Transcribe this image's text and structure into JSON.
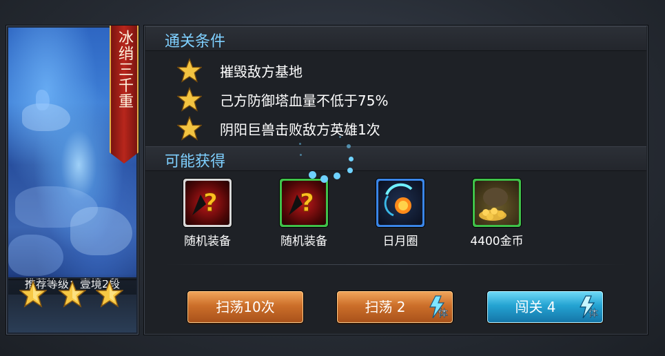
{
  "stage": {
    "name": "冰绡三千重",
    "recommended_level": "推荐等级：壹境2段",
    "stars": 3
  },
  "conditions": {
    "title": "通关条件",
    "items": [
      "摧毁敌方基地",
      "己方防御塔血量不低于75%",
      "阴阳巨兽击败敌方英雄1次"
    ]
  },
  "rewards": {
    "title": "可能获得",
    "items": [
      {
        "label": "随机装备",
        "icon": "random-equipment-icon",
        "frame": "#d9d9d9"
      },
      {
        "label": "随机装备",
        "icon": "random-equipment-icon",
        "frame": "#3fc24a"
      },
      {
        "label": "日月圈",
        "icon": "sun-moon-ring-icon",
        "frame": "#3a86e8"
      },
      {
        "label": "4400金币",
        "icon": "gold-coin-pile-icon",
        "frame": "#3fc24a"
      }
    ]
  },
  "buttons": {
    "sweep10": "扫荡10次",
    "sweep": "扫荡 2",
    "challenge": "闯关 4",
    "stamina_label": "体"
  },
  "colors": {
    "accent_title": "#7fd0ff",
    "button_orange": "#cc6f2a",
    "button_blue": "#24a3d2"
  }
}
